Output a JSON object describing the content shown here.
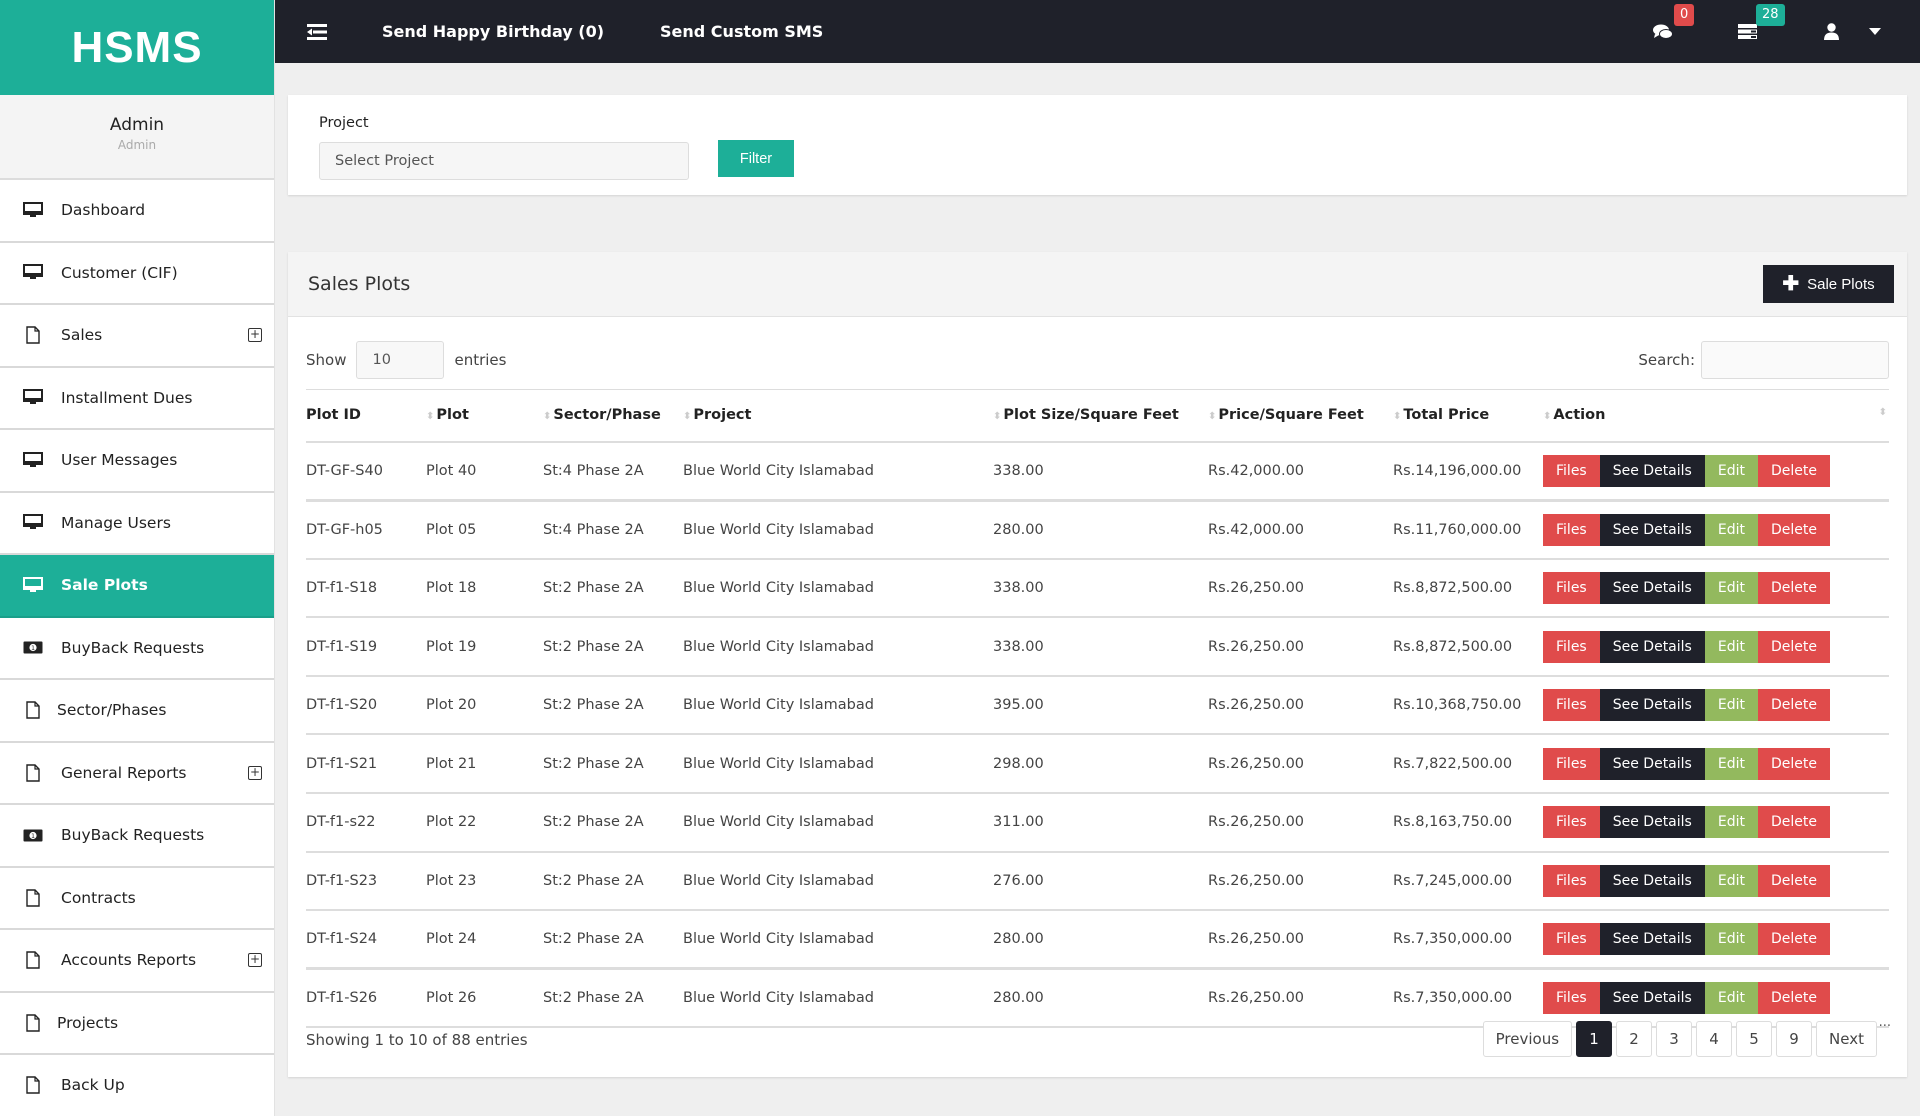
{
  "brand": "HSMS",
  "profile": {
    "name": "Admin",
    "role": "Admin"
  },
  "sidebar": {
    "items": [
      {
        "label": "Dashboard",
        "icon": "monitor-icon",
        "expandable": false,
        "active": false
      },
      {
        "label": "Customer (CIF)",
        "icon": "monitor-icon",
        "expandable": false,
        "active": false
      },
      {
        "label": "Sales",
        "icon": "file-icon",
        "expandable": true,
        "active": false
      },
      {
        "label": "Installment Dues",
        "icon": "monitor-icon",
        "expandable": false,
        "active": false
      },
      {
        "label": "User Messages",
        "icon": "monitor-icon",
        "expandable": false,
        "active": false
      },
      {
        "label": "Manage Users",
        "icon": "monitor-icon",
        "expandable": false,
        "active": false
      },
      {
        "label": "Sale Plots",
        "icon": "monitor-icon",
        "expandable": false,
        "active": true
      },
      {
        "label": "BuyBack Requests",
        "icon": "money-icon",
        "expandable": false,
        "active": false
      },
      {
        "label": "Sector/Phases",
        "icon": "file-icon",
        "expandable": false,
        "active": false
      },
      {
        "label": "General Reports",
        "icon": "file-icon",
        "expandable": true,
        "active": false
      },
      {
        "label": "BuyBack Requests",
        "icon": "money-icon",
        "expandable": false,
        "active": false
      },
      {
        "label": "Contracts",
        "icon": "file-icon",
        "expandable": false,
        "active": false
      },
      {
        "label": "Accounts Reports",
        "icon": "file-icon",
        "expandable": true,
        "active": false
      },
      {
        "label": "Projects",
        "icon": "file-icon",
        "expandable": false,
        "active": false
      },
      {
        "label": "Back Up",
        "icon": "file-icon",
        "expandable": false,
        "active": false
      }
    ]
  },
  "header": {
    "links": [
      "Send Happy Birthday (0)",
      "Send Custom SMS"
    ],
    "messages_badge": "0",
    "tasks_badge": "28"
  },
  "filter": {
    "label": "Project",
    "select_placeholder": "Select Project",
    "button": "Filter"
  },
  "panel": {
    "title": "Sales Plots",
    "add_button": "Sale Plots",
    "show_label": "Show",
    "show_value": "10",
    "entries_label": "entries",
    "search_label": "Search:",
    "search_value": ""
  },
  "table": {
    "columns": [
      "Plot ID",
      "Plot",
      "Sector/Phase",
      "Project",
      "Plot Size/Square Feet",
      "Price/Square Feet",
      "Total Price",
      "Action"
    ],
    "action_labels": {
      "files": "Files",
      "details": "See Details",
      "edit": "Edit",
      "delete": "Delete"
    },
    "rows": [
      [
        "DT-GF-S40",
        "Plot 40",
        "St:4 Phase 2A",
        "Blue World City Islamabad",
        "338.00",
        "Rs.42,000.00",
        "Rs.14,196,000.00"
      ],
      [
        "DT-GF-h05",
        "Plot 05",
        "St:4 Phase 2A",
        "Blue World City Islamabad",
        "280.00",
        "Rs.42,000.00",
        "Rs.11,760,000.00"
      ],
      [
        "DT-f1-S18",
        "Plot 18",
        "St:2 Phase 2A",
        "Blue World City Islamabad",
        "338.00",
        "Rs.26,250.00",
        "Rs.8,872,500.00"
      ],
      [
        "DT-f1-S19",
        "Plot 19",
        "St:2 Phase 2A",
        "Blue World City Islamabad",
        "338.00",
        "Rs.26,250.00",
        "Rs.8,872,500.00"
      ],
      [
        "DT-f1-S20",
        "Plot 20",
        "St:2 Phase 2A",
        "Blue World City Islamabad",
        "395.00",
        "Rs.26,250.00",
        "Rs.10,368,750.00"
      ],
      [
        "DT-f1-S21",
        "Plot 21",
        "St:2 Phase 2A",
        "Blue World City Islamabad",
        "298.00",
        "Rs.26,250.00",
        "Rs.7,822,500.00"
      ],
      [
        "DT-f1-s22",
        "Plot 22",
        "St:2 Phase 2A",
        "Blue World City Islamabad",
        "311.00",
        "Rs.26,250.00",
        "Rs.8,163,750.00"
      ],
      [
        "DT-f1-S23",
        "Plot 23",
        "St:2 Phase 2A",
        "Blue World City Islamabad",
        "276.00",
        "Rs.26,250.00",
        "Rs.7,245,000.00"
      ],
      [
        "DT-f1-S24",
        "Plot 24",
        "St:2 Phase 2A",
        "Blue World City Islamabad",
        "280.00",
        "Rs.26,250.00",
        "Rs.7,350,000.00"
      ],
      [
        "DT-f1-S26",
        "Plot 26",
        "St:2 Phase 2A",
        "Blue World City Islamabad",
        "280.00",
        "Rs.26,250.00",
        "Rs.7,350,000.00"
      ]
    ]
  },
  "footer": {
    "info": "Showing 1 to 10 of 88 entries",
    "pagination": {
      "previous": "Previous",
      "next": "Next",
      "pages": [
        "1",
        "2",
        "3",
        "4",
        "5",
        "9"
      ],
      "current": "1",
      "ellipsis": "..."
    }
  },
  "colors": {
    "brand": "#1daf98",
    "dark": "#1f212a",
    "danger": "#e04b4b",
    "success": "#93b95e"
  }
}
